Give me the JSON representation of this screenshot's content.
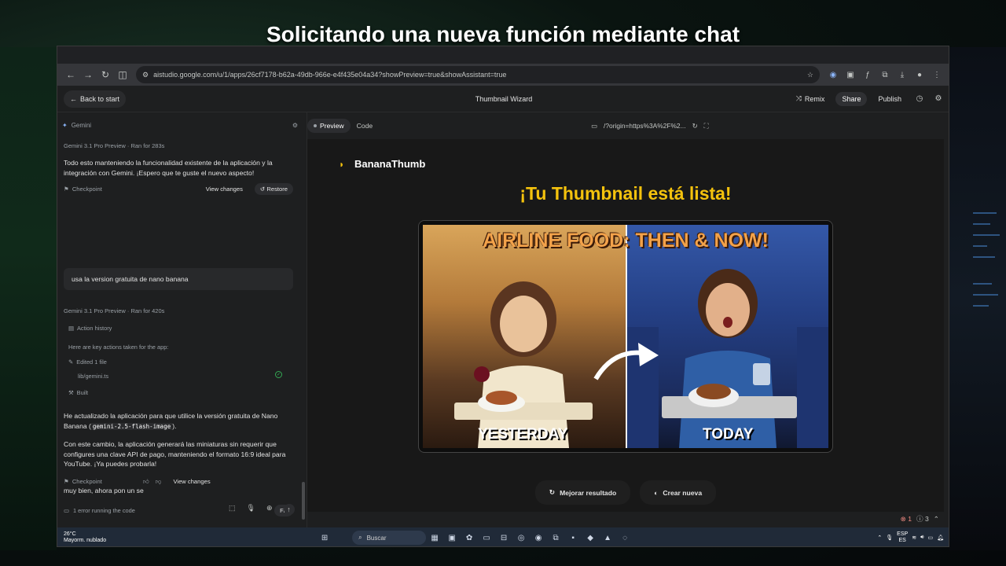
{
  "video_caption": "Solicitando una nueva función mediante chat",
  "browser": {
    "url": "aistudio.google.com/u/1/apps/26cf7178-b62a-49db-966e-e4f435e04a34?showPreview=true&showAssistant=true"
  },
  "app_header": {
    "back_label": "Back to start",
    "title": "Thumbnail Wizard",
    "remix": "Remix",
    "share": "Share",
    "publish": "Publish"
  },
  "chat": {
    "panel_label": "Gemini",
    "msg1_meta_model": "Gemini 3.1 Pro Preview",
    "msg1_meta_time": "Ran for 283s",
    "msg1_text": "Todo esto manteniendo la funcionalidad existente de la aplicación y la integración con Gemini. ¡Espero que te guste el nuevo aspecto!",
    "checkpoint": "Checkpoint",
    "view_changes": "View changes",
    "restore": "Restore",
    "user_msg": "usa la version gratuita de nano banana",
    "msg2_meta_model": "Gemini 3.1 Pro Preview",
    "msg2_meta_time": "Ran for 420s",
    "action_history": "Action history",
    "key_actions": "Here are key actions taken for the app:",
    "edited": "Edited 1 file",
    "file": "lib/gemini.ts",
    "built": "Built",
    "msg2_text_a": "He actualizado la aplicación para que utilice la versión gratuita de Nano Banana (",
    "msg2_code": "gemini-2.5-flash-image",
    "msg2_text_b": ").",
    "msg2_text_c": "Con este cambio, la aplicación generará las miniaturas sin requerir que configures una clave API de pago, manteniendo el formato 16:9 ideal para YouTube. ¡Ya puedes probarla!",
    "error": "1 error running the code",
    "fix": "Fix",
    "input_text": "muy bien, ahora pon un se"
  },
  "preview": {
    "tab_preview": "Preview",
    "tab_code": "Code",
    "origin": "/?origin=https%3A%2F%2...",
    "brand": "BananaThumb",
    "headline": "¡Tu Thumbnail está lista!",
    "thumb_title": "AIRLINE FOOD: THEN & NOW!",
    "cap_left": "YESTERDAY",
    "cap_right": "TODAY",
    "btn_improve": "Mejorar resultado",
    "btn_new": "Crear nueva",
    "status_errors": "1",
    "status_info": "3"
  },
  "taskbar": {
    "temp": "26°C",
    "weather": "Mayorm. nublado",
    "search": "Buscar",
    "lang": "ESP",
    "lang2": "ES"
  }
}
